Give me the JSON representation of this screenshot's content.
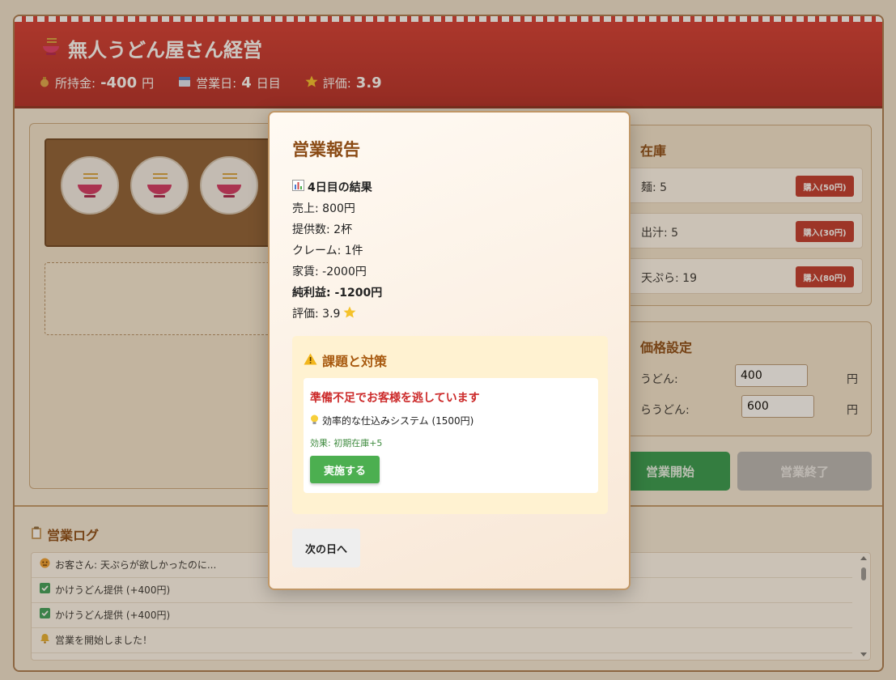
{
  "header": {
    "title": "無人うどん屋さん経営",
    "money_label": "所持金:",
    "money_value": "-400",
    "money_unit": "円",
    "day_label": "営業日:",
    "day_value": "4",
    "day_unit": "日目",
    "rating_label": "評価:",
    "rating_value": "3.9"
  },
  "inventory": {
    "title": "在庫",
    "items": [
      {
        "label": "麺: 5",
        "buy_label": "購入(50円)"
      },
      {
        "label": "出汁: 5",
        "buy_label": "購入(30円)"
      },
      {
        "label": "天ぷら: 19",
        "buy_label": "購入(80円)"
      }
    ]
  },
  "price": {
    "title": "価格設定",
    "rows": [
      {
        "label": "うどん:",
        "value": "400",
        "unit": "円"
      },
      {
        "label": "らうどん:",
        "value": "600",
        "unit": "円"
      }
    ]
  },
  "controls": {
    "start_label": "営業開始",
    "end_label": "営業終了"
  },
  "log": {
    "title": "営業ログ",
    "items": [
      {
        "text": "お客さん: 天ぷらが欲しかったのに...",
        "icon": "angry-face-icon"
      },
      {
        "text": "かけうどん提供 (+400円)",
        "icon": "check-icon"
      },
      {
        "text": "かけうどん提供 (+400円)",
        "icon": "check-icon"
      },
      {
        "text": "営業を開始しました！",
        "icon": "bell-icon"
      }
    ]
  },
  "modal": {
    "title": "営業報告",
    "results_heading": "4日目の結果",
    "sales": "売上: 800円",
    "served": "提供数: 2杯",
    "complaints": "クレーム: 1件",
    "rent": "家賃: -2000円",
    "net_profit": "純利益: -1200円",
    "rating": "評価: 3.9",
    "issues_title": "課題と対策",
    "issue_problem": "準備不足でお客様を逃しています",
    "issue_solution": "効率的な仕込みシステム (1500円)",
    "issue_effect": "効果: 初期在庫+5",
    "apply_label": "実施する",
    "next_label": "次の日へ"
  },
  "colors": {
    "accent_red": "#c0362c",
    "header_red": "#d63a33",
    "green": "#4caf50",
    "brown": "#8a4a14"
  }
}
